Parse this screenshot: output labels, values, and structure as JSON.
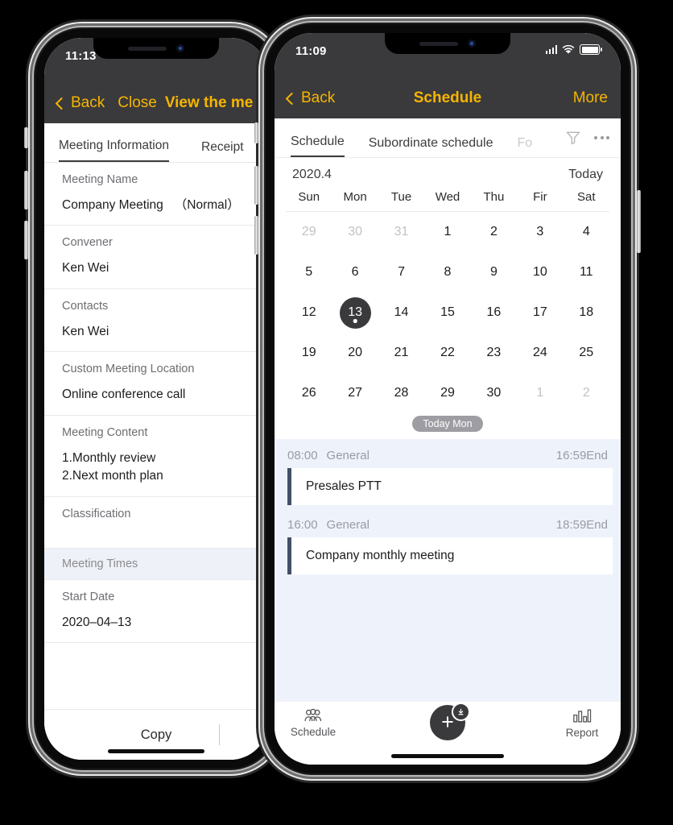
{
  "left_phone": {
    "status": {
      "time": "11:13"
    },
    "nav": {
      "back": "Back",
      "close": "Close",
      "title": "View the me"
    },
    "tabs": [
      {
        "label": "Meeting Information",
        "active": true
      },
      {
        "label": "Receipt",
        "active": false
      }
    ],
    "fields": [
      {
        "label": "Meeting Name",
        "value": "Company Meeting",
        "suffix": "（Normal）"
      },
      {
        "label": "Convener",
        "value": "Ken Wei",
        "suffix": ""
      },
      {
        "label": "Contacts",
        "value": "Ken Wei",
        "suffix": ""
      },
      {
        "label": "Custom Meeting Location",
        "value": "Online conference call",
        "suffix": ""
      },
      {
        "label": "Meeting Content",
        "value": "1.Monthly review\n2.Next month plan",
        "suffix": ""
      },
      {
        "label": "Classification",
        "value": "",
        "suffix": ""
      }
    ],
    "section_header": "Meeting Times",
    "start": {
      "label": "Start Date",
      "value": "2020–04–13"
    },
    "footer": {
      "copy": "Copy"
    }
  },
  "right_phone": {
    "status": {
      "time": "11:09"
    },
    "nav": {
      "back": "Back",
      "title": "Schedule",
      "more": "More"
    },
    "tabs": [
      {
        "label": "Schedule",
        "active": true
      },
      {
        "label": "Subordinate schedule",
        "active": false
      },
      {
        "label": "Fo",
        "active": false
      }
    ],
    "icons": {
      "filter": "funnel-icon",
      "overflow": "more-horizontal-icon"
    },
    "calendar": {
      "month": "2020.4",
      "today_label": "Today",
      "weekdays": [
        "Sun",
        "Mon",
        "Tue",
        "Wed",
        "Thu",
        "Fir",
        "Sat"
      ],
      "selected_day": 13,
      "today_pill": "Today Mon",
      "days": [
        {
          "n": "29",
          "muted": true
        },
        {
          "n": "30",
          "muted": true
        },
        {
          "n": "31",
          "muted": true
        },
        {
          "n": "1"
        },
        {
          "n": "2"
        },
        {
          "n": "3"
        },
        {
          "n": "4"
        },
        {
          "n": "5"
        },
        {
          "n": "6"
        },
        {
          "n": "7"
        },
        {
          "n": "8"
        },
        {
          "n": "9"
        },
        {
          "n": "10"
        },
        {
          "n": "11"
        },
        {
          "n": "12"
        },
        {
          "n": "13",
          "selected": true
        },
        {
          "n": "14"
        },
        {
          "n": "15"
        },
        {
          "n": "16"
        },
        {
          "n": "17"
        },
        {
          "n": "18"
        },
        {
          "n": "19"
        },
        {
          "n": "20"
        },
        {
          "n": "21"
        },
        {
          "n": "22"
        },
        {
          "n": "23"
        },
        {
          "n": "24"
        },
        {
          "n": "25"
        },
        {
          "n": "26"
        },
        {
          "n": "27"
        },
        {
          "n": "28"
        },
        {
          "n": "29"
        },
        {
          "n": "30"
        },
        {
          "n": "1",
          "muted": true
        },
        {
          "n": "2",
          "muted": true
        }
      ]
    },
    "events": [
      {
        "start": "08:00",
        "type": "General",
        "end": "16:59End",
        "title": "Presales PTT"
      },
      {
        "start": "16:00",
        "type": "General",
        "end": "18:59End",
        "title": "Company monthly meeting"
      }
    ],
    "tabbar": [
      {
        "label": "Schedule",
        "icon": "people-icon"
      },
      {
        "label": "",
        "icon": "add-circle-icon"
      },
      {
        "label": "Report",
        "icon": "bar-chart-icon"
      }
    ]
  },
  "colors": {
    "accent": "#f7b500",
    "navbar_bg": "#3a3a3c",
    "events_bg": "#eef3fb",
    "event_bar": "#425066"
  }
}
